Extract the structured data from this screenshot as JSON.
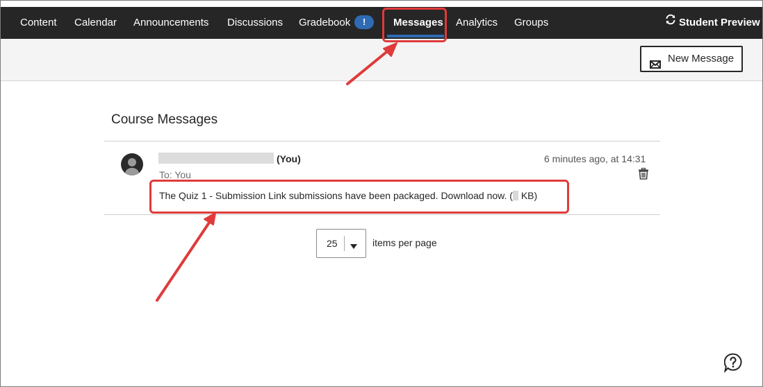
{
  "nav": {
    "items": [
      {
        "label": "Content"
      },
      {
        "label": "Calendar"
      },
      {
        "label": "Announcements"
      },
      {
        "label": "Discussions"
      },
      {
        "label": "Gradebook",
        "badge": "!"
      },
      {
        "label": "Messages",
        "active": true
      },
      {
        "label": "Analytics"
      },
      {
        "label": "Groups"
      }
    ],
    "student_preview": "Student Preview"
  },
  "toolbar": {
    "new_message_label": "New Message"
  },
  "main": {
    "heading": "Course Messages",
    "message": {
      "sender_suffix": "(You)",
      "to": "To: You",
      "time": "6 minutes ago, at 14:31",
      "body_prefix": "The Quiz 1 - Submission Link submissions have been packaged. Download now. (",
      "body_suffix": " KB)"
    },
    "pagination": {
      "per_page_value": "25",
      "per_page_label": "items per page"
    }
  },
  "colors": {
    "nav_bg": "#262626",
    "accent": "#2e6bb3",
    "annotation": "#e03a3a"
  },
  "icons": [
    "student-preview-icon",
    "envelope-icon",
    "trash-icon",
    "caret-down-icon",
    "help-icon"
  ]
}
